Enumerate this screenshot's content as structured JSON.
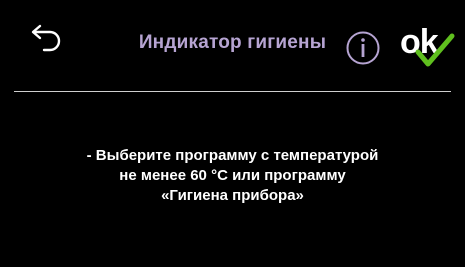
{
  "header": {
    "title": "Индикатор гигиены",
    "back_icon": "back-arrow-icon",
    "info_icon": "info-icon",
    "ok_label": "ok",
    "ok_check_icon": "checkmark-icon",
    "title_color": "#b6a4d2",
    "check_color": "#5fbf1e"
  },
  "message": {
    "lines": [
      "- Выберите программу с температурой",
      "не менее 60 °C или программу",
      "«Гигиена прибора»"
    ]
  }
}
